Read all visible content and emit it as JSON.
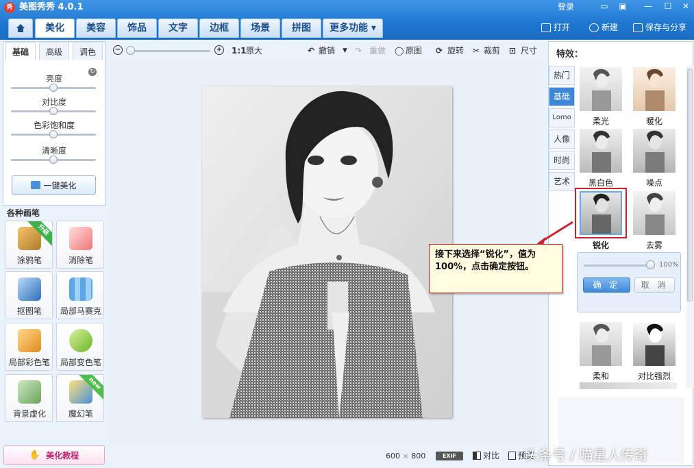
{
  "app": {
    "logo_text": "秀",
    "title": "美图秀秀 4.0.1",
    "login": "登录"
  },
  "window": {
    "min": "—",
    "max": "☐",
    "close": "✕",
    "msg": "▭",
    "skin": "▣"
  },
  "nav_tabs": [
    {
      "label": "美化",
      "active": true
    },
    {
      "label": "美容"
    },
    {
      "label": "饰品"
    },
    {
      "label": "文字"
    },
    {
      "label": "边框"
    },
    {
      "label": "场景"
    },
    {
      "label": "拼图"
    },
    {
      "label": "更多功能 ▾"
    }
  ],
  "header_actions": {
    "open": "打开",
    "new": "新建",
    "save": "保存与分享"
  },
  "left": {
    "tabs": [
      "基础",
      "高级",
      "调色"
    ],
    "sliders": [
      {
        "label": "亮度",
        "value": 0.5
      },
      {
        "label": "对比度",
        "value": 0.5
      },
      {
        "label": "色彩饱和度",
        "value": 0.5
      },
      {
        "label": "清晰度",
        "value": 0.5
      }
    ],
    "onekey": "一键美化",
    "brushes_title": "各种画笔",
    "brushes": [
      {
        "label": "涂鸦笔",
        "ribbon": "升级"
      },
      {
        "label": "消除笔"
      },
      {
        "label": "抠图笔"
      },
      {
        "label": "局部马赛克"
      },
      {
        "label": "局部彩色笔"
      },
      {
        "label": "局部变色笔"
      },
      {
        "label": "背景虚化"
      },
      {
        "label": "魔幻笔",
        "ribbon": "new"
      }
    ],
    "tutorial": "美化教程"
  },
  "toolbar": {
    "ratio": "1:1",
    "original_size": "原大",
    "undo": "撤销",
    "redo": "重做",
    "original": "原图",
    "rotate": "旋转",
    "crop": "裁剪",
    "size": "尺寸"
  },
  "status": {
    "width": "600",
    "x": "×",
    "height": "800",
    "exif": "EXIF",
    "compare": "对比",
    "preview": "预览"
  },
  "effects": {
    "title": "特效：",
    "categories": [
      {
        "label": "热门"
      },
      {
        "label": "基础",
        "active": true
      },
      {
        "label": "Lomo"
      },
      {
        "label": "人像"
      },
      {
        "label": "时尚"
      },
      {
        "label": "艺术"
      }
    ],
    "items": [
      "柔光",
      "暖化",
      "黑白色",
      "噪点",
      "锐化",
      "去雾",
      "柔和",
      "对比强烈"
    ],
    "selected": "锐化",
    "sharpen_value": "100%",
    "ok": "确 定",
    "cancel": "取 消"
  },
  "callout": "接下来选择“锐化”，值为100%，点击确定按钮。",
  "watermark": "头条号 / 喵星人传奇"
}
